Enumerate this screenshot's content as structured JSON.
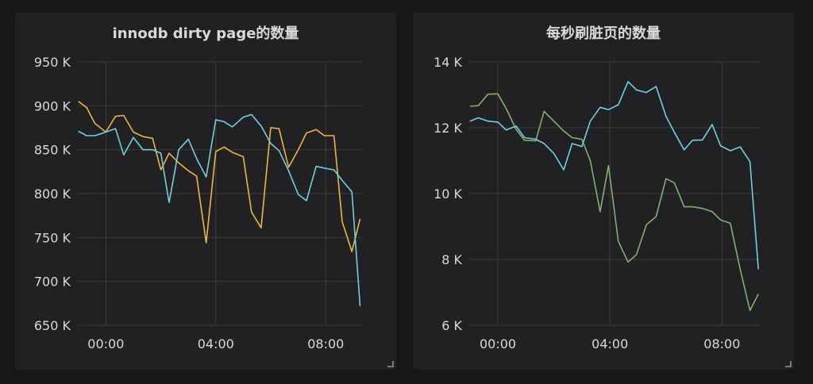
{
  "chart_data": [
    {
      "type": "line",
      "title": "innodb dirty page的数量",
      "ylim": [
        650,
        950
      ],
      "y_ticks": [
        "950 K",
        "900 K",
        "850 K",
        "800 K",
        "750 K",
        "700 K",
        "650 K"
      ],
      "y_tick_values": [
        950,
        900,
        850,
        800,
        750,
        700,
        650
      ],
      "x_ticks": [
        "00:00",
        "04:00",
        "08:00"
      ],
      "x_tick_values": [
        0,
        4,
        8
      ],
      "xlim": [
        -1.05,
        9.35
      ],
      "grid": true,
      "series": [
        {
          "color": "#eab839",
          "x": [
            -1,
            -0.7,
            -0.4,
            0,
            0.35,
            0.65,
            1,
            1.35,
            1.7,
            2,
            2.3,
            2.65,
            3,
            3.3,
            3.65,
            4,
            4.3,
            4.6,
            5,
            5.3,
            5.65,
            6,
            6.3,
            6.65,
            7,
            7.3,
            7.65,
            7.95,
            8.3,
            8.6,
            8.95,
            9.25
          ],
          "values": [
            905,
            898,
            880,
            870,
            888,
            889,
            870,
            865,
            863,
            827,
            846,
            835,
            826,
            820,
            744,
            848,
            853,
            847,
            842,
            779,
            761,
            875,
            874,
            830,
            850,
            869,
            873,
            866,
            866,
            768,
            734,
            771
          ]
        },
        {
          "color": "#6ed0e0",
          "x": [
            -1,
            -0.7,
            -0.4,
            -0.1,
            0.35,
            0.65,
            1,
            1.35,
            1.7,
            2,
            2.3,
            2.65,
            3,
            3.3,
            3.65,
            4,
            4.3,
            4.6,
            5,
            5.3,
            5.65,
            6,
            6.3,
            6.65,
            7,
            7.3,
            7.65,
            7.95,
            8.3,
            8.6,
            8.95,
            9.25
          ],
          "values": [
            871,
            866,
            866,
            869,
            874,
            844,
            864,
            850,
            850,
            846,
            790,
            850,
            862,
            840,
            819,
            884,
            882,
            876,
            887,
            890,
            877,
            857,
            849,
            826,
            799,
            792,
            831,
            829,
            827,
            815,
            802,
            672
          ]
        }
      ]
    },
    {
      "type": "line",
      "title": "每秒刷脏页的数量",
      "ylim": [
        6,
        14
      ],
      "y_ticks": [
        "14 K",
        "12 K",
        "10 K",
        "8 K",
        "6 K"
      ],
      "y_tick_values": [
        14,
        12,
        10,
        8,
        6
      ],
      "x_ticks": [
        "00:00",
        "04:00",
        "08:00"
      ],
      "x_tick_values": [
        0,
        4,
        8
      ],
      "xlim": [
        -1.05,
        9.35
      ],
      "grid": true,
      "series": [
        {
          "color": "#7eb26d",
          "x": [
            -1,
            -0.7,
            -0.35,
            0,
            0.3,
            0.65,
            0.95,
            1.35,
            1.65,
            2,
            2.35,
            2.65,
            3,
            3.3,
            3.65,
            3.95,
            4.3,
            4.65,
            4.95,
            5.3,
            5.65,
            6,
            6.3,
            6.65,
            6.95,
            7.3,
            7.65,
            7.95,
            8.3,
            8.65,
            9,
            9.3
          ],
          "values": [
            12.65,
            12.67,
            13.02,
            13.03,
            12.58,
            11.95,
            11.62,
            11.6,
            12.5,
            12.2,
            11.9,
            11.7,
            11.65,
            11.0,
            9.45,
            10.85,
            8.55,
            7.92,
            8.15,
            9.05,
            9.3,
            10.45,
            10.33,
            9.6,
            9.6,
            9.55,
            9.45,
            9.2,
            9.1,
            7.7,
            6.45,
            6.95
          ]
        },
        {
          "color": "#6ed0e0",
          "x": [
            -1,
            -0.7,
            -0.35,
            0,
            0.3,
            0.65,
            0.95,
            1.35,
            1.65,
            2,
            2.35,
            2.65,
            3,
            3.3,
            3.65,
            3.95,
            4.3,
            4.65,
            4.95,
            5.3,
            5.65,
            6,
            6.3,
            6.65,
            6.95,
            7.3,
            7.65,
            7.95,
            8.3,
            8.65,
            9,
            9.3
          ],
          "values": [
            12.2,
            12.3,
            12.2,
            12.17,
            11.93,
            12.05,
            11.7,
            11.65,
            11.52,
            11.22,
            10.72,
            11.52,
            11.43,
            12.2,
            12.62,
            12.55,
            12.7,
            13.4,
            13.15,
            13.07,
            13.25,
            12.35,
            11.86,
            11.33,
            11.62,
            11.63,
            12.1,
            11.45,
            11.3,
            11.42,
            10.97,
            7.7
          ]
        }
      ]
    }
  ]
}
